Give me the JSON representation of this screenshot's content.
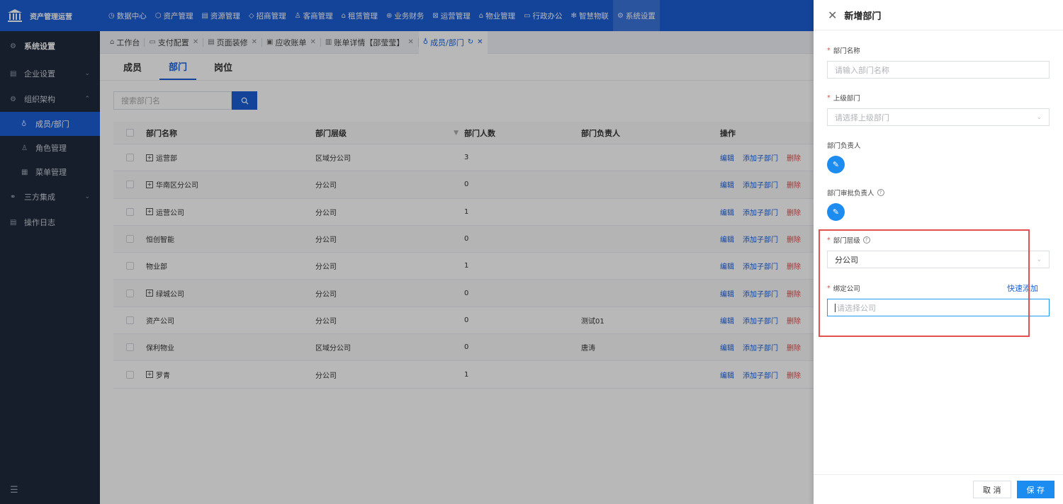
{
  "app": {
    "title": "资产管理运营"
  },
  "nav": [
    {
      "label": "数据中心",
      "icon": "chart-icon",
      "glyph": "◷"
    },
    {
      "label": "资产管理",
      "icon": "cube-icon",
      "glyph": "⬡"
    },
    {
      "label": "资源管理",
      "icon": "building-icon",
      "glyph": "▤"
    },
    {
      "label": "招商管理",
      "icon": "tag-icon",
      "glyph": "◇"
    },
    {
      "label": "客商管理",
      "icon": "people-icon",
      "glyph": "♙"
    },
    {
      "label": "租赁管理",
      "icon": "house-icon",
      "glyph": "⌂"
    },
    {
      "label": "业务财务",
      "icon": "money-icon",
      "glyph": "⊕"
    },
    {
      "label": "运营管理",
      "icon": "ops-icon",
      "glyph": "⊠"
    },
    {
      "label": "物业管理",
      "icon": "property-icon",
      "glyph": "⌂"
    },
    {
      "label": "行政办公",
      "icon": "office-icon",
      "glyph": "▭"
    },
    {
      "label": "智慧物联",
      "icon": "iot-icon",
      "glyph": "✻"
    },
    {
      "label": "系统设置",
      "icon": "settings-icon",
      "glyph": "⚙"
    }
  ],
  "sidebar": {
    "header": "系统设置",
    "items": [
      {
        "label": "企业设置",
        "chevron": "⌄"
      },
      {
        "label": "组织架构",
        "chevron": "⌃"
      },
      {
        "label": "成员/部门"
      },
      {
        "label": "角色管理"
      },
      {
        "label": "菜单管理"
      },
      {
        "label": "三方集成",
        "chevron": "⌄"
      },
      {
        "label": "操作日志"
      }
    ]
  },
  "tabs": [
    {
      "label": "工作台"
    },
    {
      "label": "支付配置"
    },
    {
      "label": "页面装修"
    },
    {
      "label": "应收账单"
    },
    {
      "label": "账单详情【邵莹莹】"
    },
    {
      "label": "成员/部门"
    }
  ],
  "subtabs": [
    "成员",
    "部门",
    "岗位"
  ],
  "search": {
    "placeholder": "搜索部门名"
  },
  "table": {
    "headers": [
      "部门名称",
      "部门层级",
      "部门人数",
      "部门负责人",
      "操作"
    ],
    "ops": [
      "编辑",
      "添加子部门",
      "删除"
    ],
    "rows": [
      {
        "name": "运营部",
        "level": "区域分公司",
        "count": "3",
        "lead": "",
        "expand": true
      },
      {
        "name": "华南区分公司",
        "level": "分公司",
        "count": "0",
        "lead": "",
        "expand": true
      },
      {
        "name": "运营公司",
        "level": "分公司",
        "count": "1",
        "lead": "",
        "expand": true
      },
      {
        "name": "恒创智能",
        "level": "分公司",
        "count": "0",
        "lead": "",
        "expand": false
      },
      {
        "name": "物业部",
        "level": "分公司",
        "count": "1",
        "lead": "",
        "expand": false
      },
      {
        "name": "绿城公司",
        "level": "分公司",
        "count": "0",
        "lead": "",
        "expand": true
      },
      {
        "name": "资产公司",
        "level": "分公司",
        "count": "0",
        "lead": "测试01",
        "expand": false
      },
      {
        "name": "保利物业",
        "level": "区域分公司",
        "count": "0",
        "lead": "唐涛",
        "expand": false
      },
      {
        "name": "罗青",
        "level": "分公司",
        "count": "1",
        "lead": "",
        "expand": true
      }
    ]
  },
  "drawer": {
    "title": "新增部门",
    "fields": {
      "name": {
        "label": "部门名称",
        "placeholder": "请输入部门名称"
      },
      "parent": {
        "label": "上级部门",
        "placeholder": "请选择上级部门"
      },
      "leader": {
        "label": "部门负责人"
      },
      "approver": {
        "label": "部门审批负责人"
      },
      "level": {
        "label": "部门层级",
        "value": "分公司"
      },
      "company": {
        "label": "绑定公司",
        "placeholder": "请选择公司",
        "quick_add": "快速添加"
      }
    },
    "cancel_label": "取 消",
    "save_label": "保 存"
  },
  "colors": {
    "primary": "#1d5fd6",
    "danger": "#e04b4b",
    "sidebar": "#1f2a3c"
  }
}
